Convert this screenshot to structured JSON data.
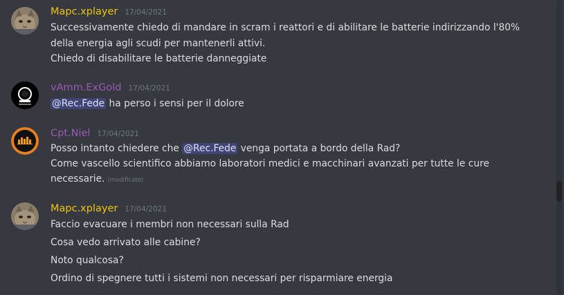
{
  "colors": {
    "background": "#36393f",
    "text": "#dcddde",
    "timestamp": "#72767d",
    "mapc": "#f1c40f",
    "vamm": "#9b59b6",
    "niel": "#9b59b6"
  },
  "messages": [
    {
      "author": "Mapc.xplayer",
      "timestamp": "17/04/2021",
      "avatar": "cat-avatar",
      "lines": [
        "Successivamente chiedo di mandare in scram i reattori e di abilitare le batterie indirizzando l'80%",
        "della energia agli scudi per mantenerli attivi.",
        "Chiedo di disabilitare le batterie danneggiate"
      ]
    },
    {
      "author": "vAmm.ExGold",
      "timestamp": "17/04/2021",
      "avatar": "astronaut-avatar",
      "mention": "@Rec.Fede",
      "text_after_mention": " ha perso i sensi per il dolore"
    },
    {
      "author": "Cpt.Niel",
      "timestamp": "17/04/2021",
      "avatar": "sunset-skyline-avatar",
      "line1_before": "Posso intanto chiedere che ",
      "line1_mention": "@Rec.Fede",
      "line1_after": " venga portata a bordo della Rad?",
      "line2": "Come vascello scientifico abbiamo laboratori medici e macchinari avanzati per tutte le cure",
      "line3": "necessarie.",
      "edited": "(modificato)"
    },
    {
      "author": "Mapc.xplayer",
      "timestamp": "17/04/2021",
      "avatar": "cat-avatar",
      "lines": [
        "Faccio evacuare i membri non necessari sulla Rad",
        "Cosa vedo arrivato alle cabine?",
        "Noto qualcosa?",
        "Ordino di spegnere tutti i sistemi non necessari per risparmiare energia"
      ]
    }
  ]
}
